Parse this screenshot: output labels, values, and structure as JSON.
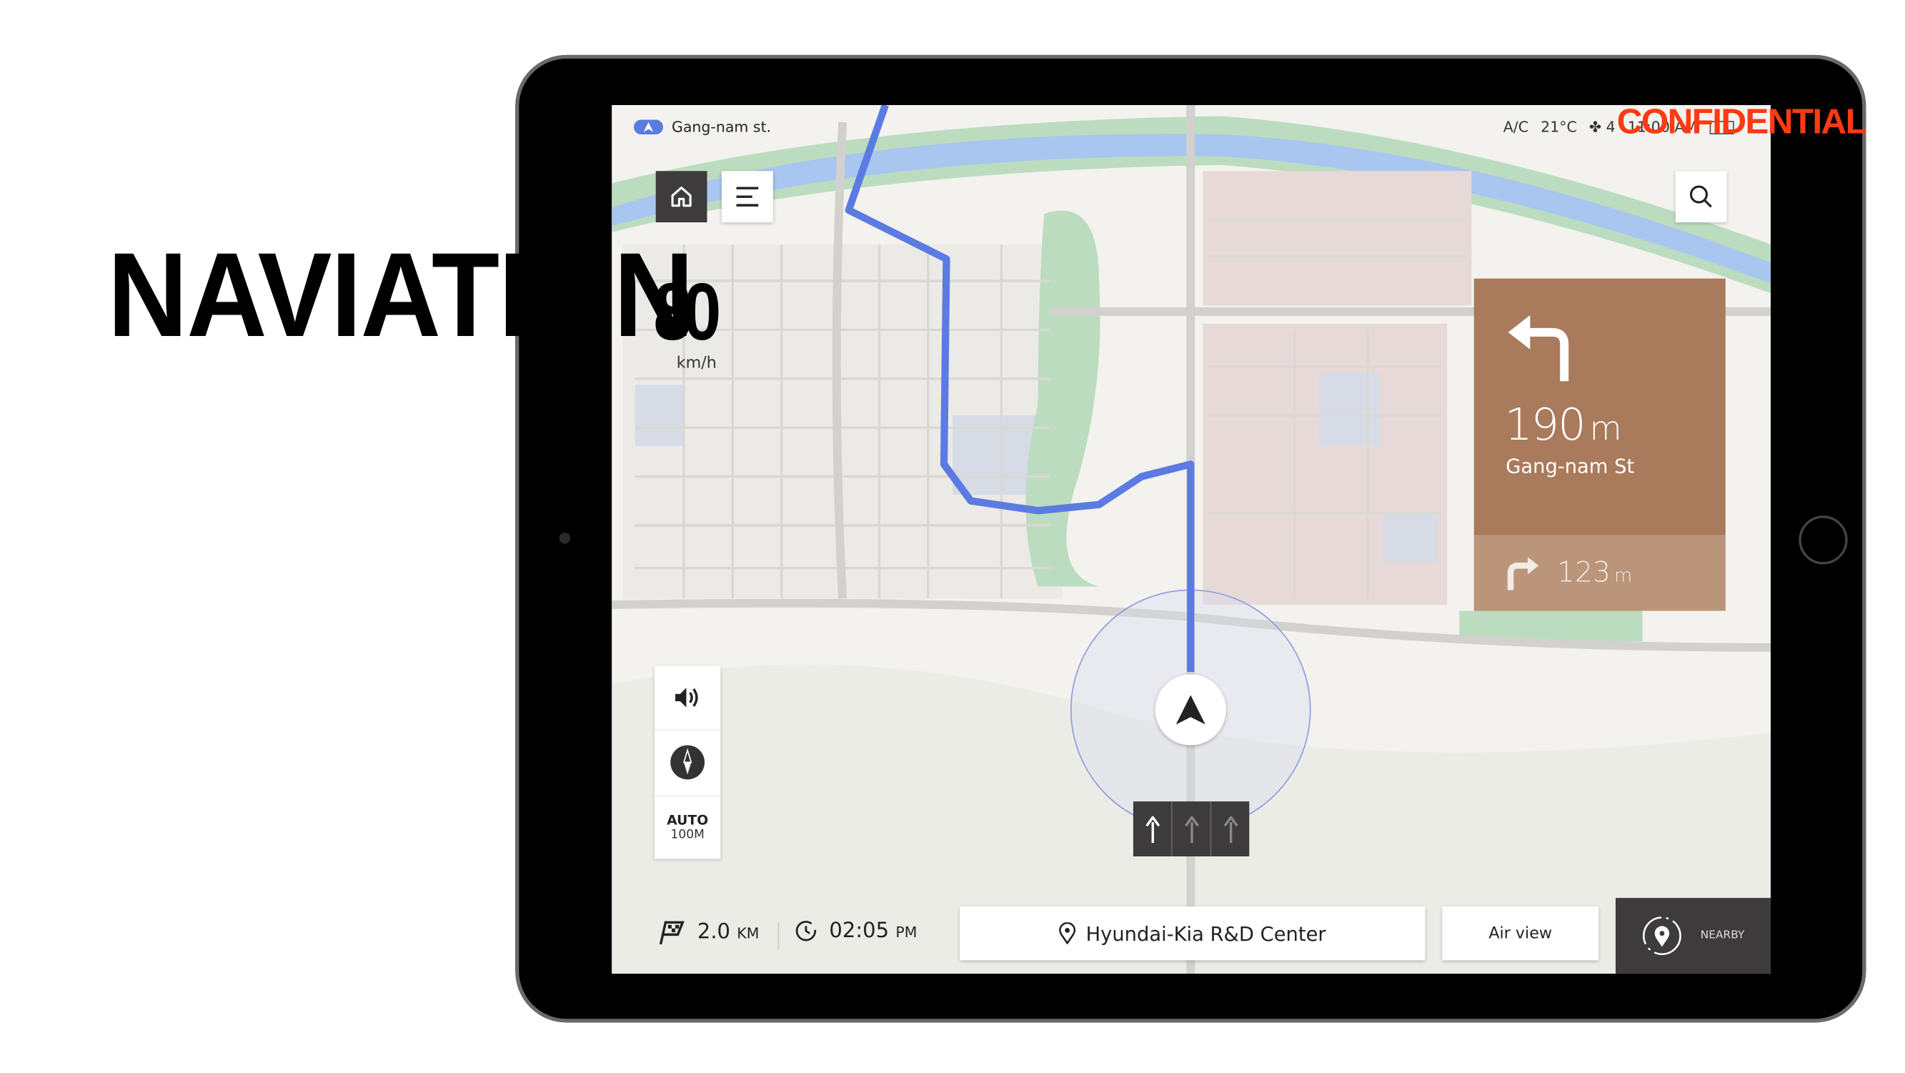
{
  "overlay_title": "NAVIATION",
  "confidential_label": "CONFIDENTIAL",
  "colors": {
    "route": "#5b7be3",
    "turn_card": "#a97a5b",
    "confidential": "#ff3a12",
    "dark_button": "#3d3b3b",
    "river": "#a9c6f0",
    "park": "#bcdcbf"
  },
  "current_road": {
    "icon": "navigation-arrow-icon",
    "label": "Gang-nam st."
  },
  "status_bar": {
    "ac": "A/C",
    "temperature": "21°C",
    "fan_icon": "fan-icon",
    "fan_level": "4",
    "clock": "11:00 AM",
    "battery_icon": "battery-icon"
  },
  "speed": {
    "value": "80",
    "unit": "km/h"
  },
  "toolbar": {
    "home_icon": "home-icon",
    "menu_icon": "menu-icon",
    "search_icon": "search-icon"
  },
  "turn": {
    "icon": "turn-left-icon",
    "distance": "190",
    "unit": "m",
    "street": "Gang-nam St",
    "next": {
      "icon": "turn-right-icon",
      "distance": "123",
      "unit": "m"
    }
  },
  "controls": {
    "volume_icon": "volume-icon",
    "compass_icon": "compass-icon",
    "zoom_mode": "AUTO",
    "zoom_scale": "100M"
  },
  "lanes": [
    {
      "direction": "straight",
      "active": true
    },
    {
      "direction": "straight",
      "active": false
    },
    {
      "direction": "straight",
      "active": false
    }
  ],
  "bottom_bar": {
    "remaining_distance": "2.0",
    "distance_unit": "KM",
    "arrival_time": "02:05",
    "arrival_period": "PM",
    "destination": "Hyundai-Kia R&D Center",
    "air_view": "Air view",
    "nearby": "NEARBY"
  }
}
